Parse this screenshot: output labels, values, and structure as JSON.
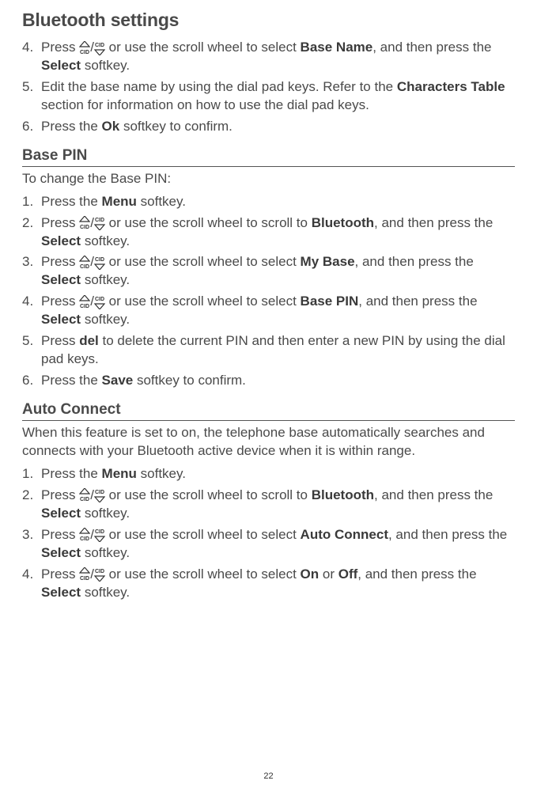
{
  "title": "Bluetooth settings",
  "pageNumber": "22",
  "sectionA": {
    "items": [
      {
        "num": "4.",
        "pre": "Press ",
        "post1": " or use the scroll wheel to select ",
        "bold1": "Base Name",
        "mid": ", and then press the ",
        "bold2": "Select",
        "end": " softkey."
      },
      {
        "num": "5.",
        "text1": "Edit the base name by using the dial pad keys. Refer to the ",
        "bold1": "Characters Table",
        "text2": " section for information on how to use the dial pad keys."
      },
      {
        "num": "6.",
        "text1": "Press the ",
        "bold1": "Ok",
        "text2": " softkey to confirm."
      }
    ]
  },
  "sectionB": {
    "heading": "Base PIN",
    "intro": "To change the Base PIN:",
    "items": [
      {
        "num": "1.",
        "text1": "Press the ",
        "bold1": "Menu",
        "text2": " softkey."
      },
      {
        "num": "2.",
        "pre": "Press ",
        "post1": " or use the scroll wheel to scroll to ",
        "bold1": "Bluetooth",
        "mid": ", and then press the ",
        "bold2": "Select",
        "end": " softkey."
      },
      {
        "num": "3.",
        "pre": "Press ",
        "post1": " or use the scroll wheel to select ",
        "bold1": "My Base",
        "mid": ", and then press the ",
        "bold2": "Select",
        "end": " softkey."
      },
      {
        "num": "4.",
        "pre": "Press ",
        "post1": " or use the scroll wheel to select ",
        "bold1": "Base PIN",
        "mid": ", and then press the ",
        "bold2": "Select",
        "end": " softkey."
      },
      {
        "num": "5.",
        "text1": "Press ",
        "bold1": "del",
        "text2": " to delete the current PIN and then enter a new PIN by using the dial pad keys."
      },
      {
        "num": "6.",
        "text1": "Press the ",
        "bold1": "Save",
        "text2": " softkey to confirm."
      }
    ]
  },
  "sectionC": {
    "heading": "Auto Connect",
    "intro": "When this feature is set to on, the telephone base automatically searches and connects with your Bluetooth active device when it is within range.",
    "items": [
      {
        "num": "1.",
        "text1": "Press the ",
        "bold1": "Menu",
        "text2": " softkey."
      },
      {
        "num": "2.",
        "pre": "Press ",
        "post1": " or use the scroll wheel to scroll to ",
        "bold1": "Bluetooth",
        "mid": ", and then press the ",
        "bold2": "Select",
        "end": " softkey."
      },
      {
        "num": "3.",
        "pre": "Press ",
        "post1": " or use the scroll wheel to select ",
        "bold1": "Auto Connect",
        "mid": ", and then press the ",
        "bold2": "Select",
        "end": " softkey."
      },
      {
        "num": "4.",
        "pre": "Press ",
        "post1": " or use the scroll wheel to select ",
        "bold1": "On",
        "mid2": " or ",
        "bold2": "Off",
        "mid": ", and then press the ",
        "bold3": "Select",
        "end": " softkey."
      }
    ]
  }
}
